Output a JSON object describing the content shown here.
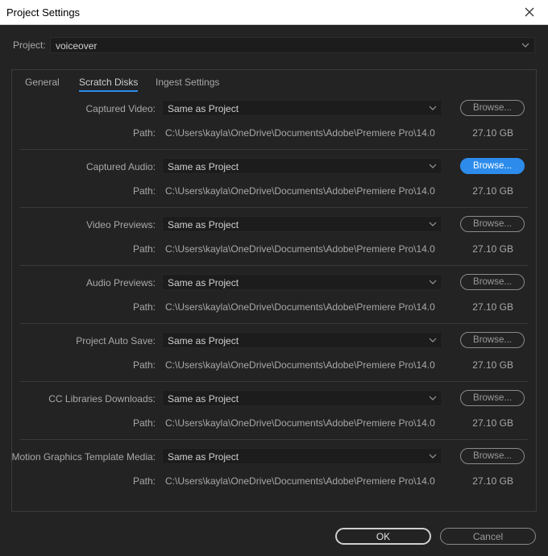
{
  "window": {
    "title": "Project Settings"
  },
  "project": {
    "label": "Project:",
    "value": "voiceover"
  },
  "tabs": [
    {
      "label": "General"
    },
    {
      "label": "Scratch Disks",
      "active": true
    },
    {
      "label": "Ingest Settings"
    }
  ],
  "scratch_disks": [
    {
      "label": "Captured Video:",
      "value": "Same as Project",
      "browse": "Browse...",
      "path_label": "Path:",
      "path": "C:\\Users\\kayla\\OneDrive\\Documents\\Adobe\\Premiere Pro\\14.0",
      "size": "27.10 GB"
    },
    {
      "label": "Captured Audio:",
      "value": "Same as Project",
      "browse": "Browse...",
      "path_label": "Path:",
      "path": "C:\\Users\\kayla\\OneDrive\\Documents\\Adobe\\Premiere Pro\\14.0",
      "size": "27.10 GB"
    },
    {
      "label": "Video Previews:",
      "value": "Same as Project",
      "browse": "Browse...",
      "path_label": "Path:",
      "path": "C:\\Users\\kayla\\OneDrive\\Documents\\Adobe\\Premiere Pro\\14.0",
      "size": "27.10 GB"
    },
    {
      "label": "Audio Previews:",
      "value": "Same as Project",
      "browse": "Browse...",
      "path_label": "Path:",
      "path": "C:\\Users\\kayla\\OneDrive\\Documents\\Adobe\\Premiere Pro\\14.0",
      "size": "27.10 GB"
    },
    {
      "label": "Project Auto Save:",
      "value": "Same as Project",
      "browse": "Browse...",
      "path_label": "Path:",
      "path": "C:\\Users\\kayla\\OneDrive\\Documents\\Adobe\\Premiere Pro\\14.0",
      "size": "27.10 GB"
    },
    {
      "label": "CC Libraries Downloads:",
      "value": "Same as Project",
      "browse": "Browse...",
      "path_label": "Path:",
      "path": "C:\\Users\\kayla\\OneDrive\\Documents\\Adobe\\Premiere Pro\\14.0",
      "size": "27.10 GB"
    },
    {
      "label": "Motion Graphics Template Media:",
      "value": "Same as Project",
      "browse": "Browse...",
      "path_label": "Path:",
      "path": "C:\\Users\\kayla\\OneDrive\\Documents\\Adobe\\Premiere Pro\\14.0",
      "size": "27.10 GB"
    }
  ],
  "buttons": {
    "ok": "OK",
    "cancel": "Cancel"
  },
  "colors": {
    "accent": "#2d8ceb",
    "background": "#232323",
    "field": "#1c1c1c"
  },
  "icons": {
    "close": "close-icon",
    "dropdown": "chevron-down-icon"
  }
}
